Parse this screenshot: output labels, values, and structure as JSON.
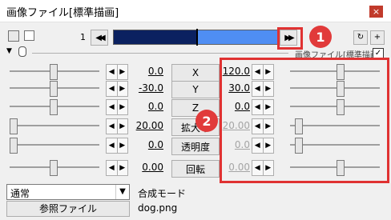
{
  "window": {
    "title": "画像ファイル[標準描画]",
    "close_label": "×"
  },
  "toolbar": {
    "frame": "1",
    "prev_label": "◀◀",
    "next_label": "▶▶",
    "timeline_progress": 0.5
  },
  "filter": {
    "title": "画像ファイル[標準描画]",
    "checkbox_checked": true,
    "checkbox_mark": "✓"
  },
  "annotations": {
    "badge1": "1",
    "badge2": "2",
    "color": "#e03232"
  },
  "arrows": {
    "left": "◀",
    "right": "▶"
  },
  "params": [
    {
      "label": "X",
      "left": "0.0",
      "right": "120.0",
      "right_disabled": false
    },
    {
      "label": "Y",
      "left": "-30.0",
      "right": "30.0",
      "right_disabled": false
    },
    {
      "label": "Z",
      "left": "0.0",
      "right": "0.0",
      "right_disabled": false
    },
    {
      "label": "拡大率",
      "left": "20.00",
      "right": "20.00",
      "right_disabled": true
    },
    {
      "label": "透明度",
      "left": "0.0",
      "right": "0.0",
      "right_disabled": true
    },
    {
      "label": "回転",
      "left": "0.00",
      "right": "0.00",
      "right_disabled": true
    }
  ],
  "blend": {
    "value": "通常",
    "label": "合成モード",
    "arrow": "▼"
  },
  "ref": {
    "button_label": "参照ファイル",
    "filename": "dog.png"
  }
}
